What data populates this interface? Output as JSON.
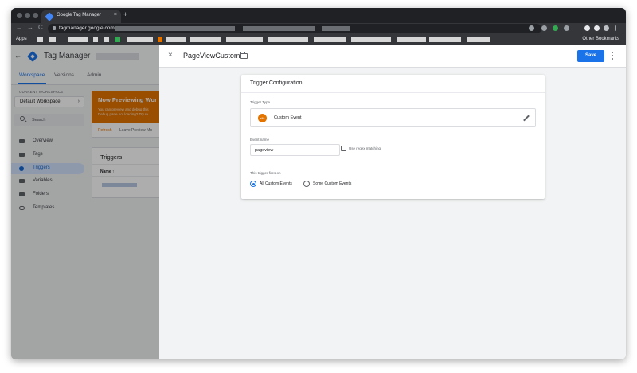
{
  "browser": {
    "tab_title": "Google Tag Manager",
    "tab_close": "×",
    "new_tab": "+",
    "url": "tagmanager.google.com",
    "nav_back": "←",
    "nav_forward": "→",
    "nav_reload": "C",
    "bookmarks_apps": "Apps",
    "bookmarks_other": "Other Bookmarks"
  },
  "app": {
    "back": "←",
    "name": "Tag Manager",
    "tabs": [
      {
        "label": "Workspace"
      },
      {
        "label": "Versions"
      },
      {
        "label": "Admin"
      }
    ]
  },
  "sidebar": {
    "current_workspace_label": "CURRENT WORKSPACE",
    "workspace_name": "Default Workspace",
    "workspace_chevron": "›",
    "search_placeholder": "Search",
    "items": [
      {
        "label": "Overview"
      },
      {
        "label": "Tags"
      },
      {
        "label": "Triggers"
      },
      {
        "label": "Variables"
      },
      {
        "label": "Folders"
      },
      {
        "label": "Templates"
      }
    ]
  },
  "preview_banner": {
    "title": "Now Previewing Wor",
    "body": "You can preview and debug this\nDebug pane not loading? Try re",
    "refresh": "Refresh",
    "leave": "Leave Preview Mo"
  },
  "triggers_list": {
    "title": "Triggers",
    "name_column": "Name ↑"
  },
  "panel": {
    "close": "×",
    "title": "PageViewCustom",
    "save": "Save"
  },
  "trigger_config": {
    "title": "Trigger Configuration",
    "type_label": "Trigger Type",
    "type_icon_text": "</>",
    "type_value": "Custom Event",
    "event_name_label": "Event name",
    "event_name_value": "pageview",
    "regex_label": "Use regex matching",
    "fires_on_label": "This trigger fires on",
    "options": [
      {
        "label": "All Custom Events",
        "selected": true
      },
      {
        "label": "Some Custom Events",
        "selected": false
      }
    ]
  },
  "colors": {
    "accent": "#1a73e8",
    "preview_orange": "#e37400"
  }
}
